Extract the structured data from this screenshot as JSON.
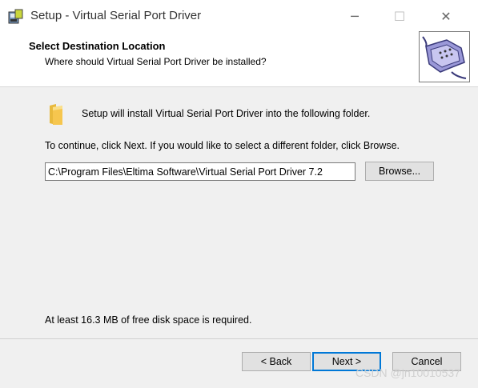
{
  "window": {
    "title": "Setup - Virtual Serial Port Driver",
    "minimize_glyph": "─",
    "maximize_glyph": "☐",
    "close_glyph": "✕"
  },
  "header": {
    "title": "Select Destination Location",
    "subtitle": "Where should Virtual Serial Port Driver be installed?"
  },
  "body": {
    "install_text": "Setup will install Virtual Serial Port Driver into the following folder.",
    "continue_text": "To continue, click Next. If you would like to select a different folder, click Browse.",
    "path_value": "C:\\Program Files\\Eltima Software\\Virtual Serial Port Driver 7.2",
    "browse_label": "Browse...",
    "disk_space_text": "At least 16.3 MB of free disk space is required."
  },
  "footer": {
    "back_label": "< Back",
    "next_label": "Next >",
    "cancel_label": "Cancel"
  },
  "watermark": "CSDN @jn10010537",
  "icons": {
    "app": "setup-app-icon",
    "header": "serial-port-connector-icon",
    "folder": "folder-icon"
  },
  "colors": {
    "accent": "#0078d7",
    "folder": "#f6c64e"
  }
}
